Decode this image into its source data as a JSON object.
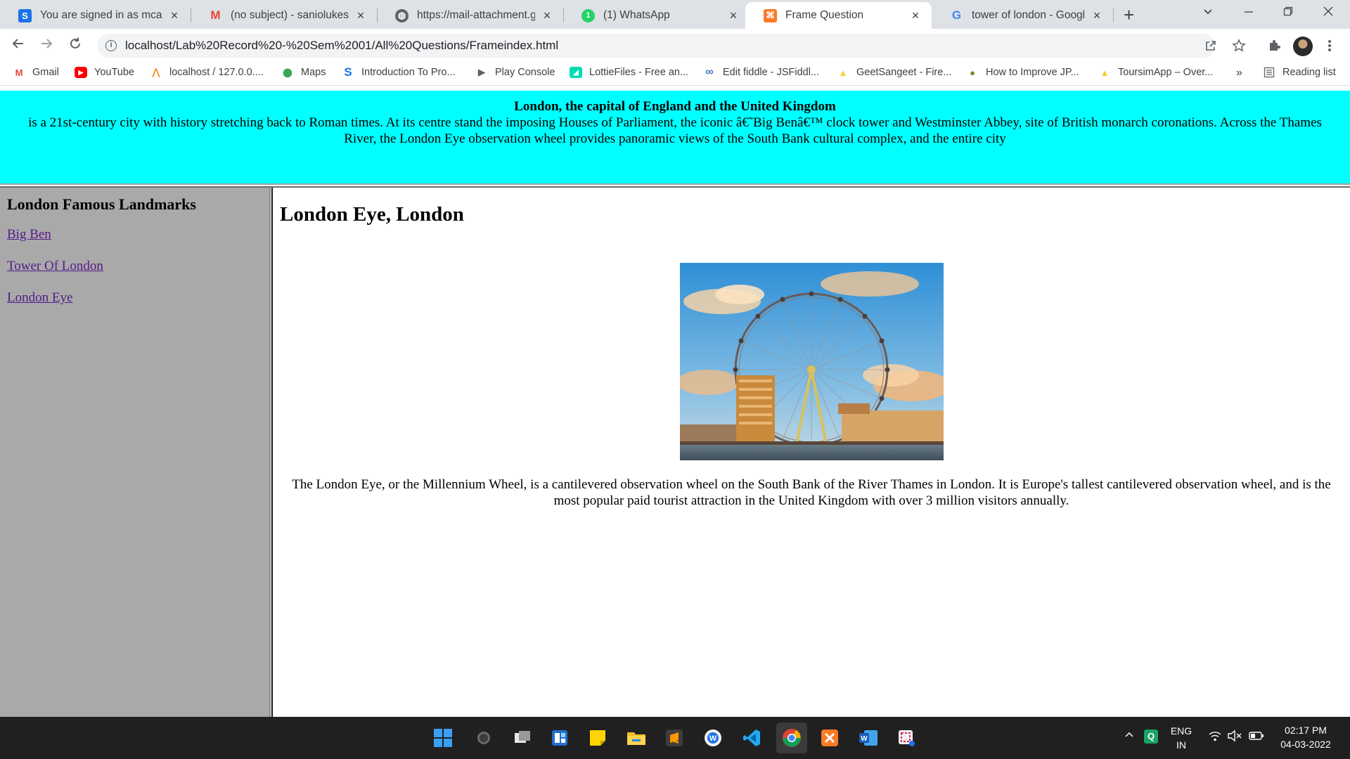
{
  "browser": {
    "tabs": [
      {
        "title": "You are signed in as mca",
        "icon": "s-icon",
        "color": "#1a73e8",
        "glyph": "S"
      },
      {
        "title": "(no subject) - saniolukeseb",
        "icon": "gmail-icon",
        "color": "#ea4335",
        "glyph": "M"
      },
      {
        "title": "https://mail-attachment.go",
        "icon": "globe-icon",
        "color": "#5f6368",
        "glyph": "◍"
      },
      {
        "title": "(1) WhatsApp",
        "icon": "whatsapp-icon",
        "color": "#25d366",
        "glyph": "1"
      },
      {
        "title": "Frame Question",
        "icon": "xampp-icon",
        "color": "#fb7a24",
        "glyph": "⌘"
      },
      {
        "title": "tower of london - Google S",
        "icon": "google-icon",
        "color": "#4285f4",
        "glyph": "G"
      }
    ],
    "close_glyph": "×",
    "new_tab_glyph": "+",
    "url": "localhost/Lab%20Record%20-%20Sem%2001/All%20Questions/Frameindex.html",
    "bookmarks": [
      {
        "label": "Gmail",
        "icon": "gmail-icon",
        "color": "#ea4335",
        "glyph": "M"
      },
      {
        "label": "YouTube",
        "icon": "youtube-icon",
        "color": "#ff0000",
        "glyph": "▶"
      },
      {
        "label": "localhost / 127.0.0....",
        "icon": "phpmyadmin-icon",
        "color": "#f29111",
        "glyph": "⋀"
      },
      {
        "label": "Maps",
        "icon": "maps-icon",
        "color": "#34a853",
        "glyph": "⬤"
      },
      {
        "label": "Introduction To Pro...",
        "icon": "s-icon",
        "color": "#1a73e8",
        "glyph": "S"
      },
      {
        "label": "Play Console",
        "icon": "play-console-icon",
        "color": "#5f6368",
        "glyph": "▶"
      },
      {
        "label": "LottieFiles - Free an...",
        "icon": "lottiefiles-icon",
        "color": "#00ddb3",
        "glyph": "◢"
      },
      {
        "label": "Edit fiddle - JSFiddl...",
        "icon": "jsfiddle-icon",
        "color": "#4679bd",
        "glyph": "∞"
      },
      {
        "label": "GeetSangeet - Fire...",
        "icon": "firebase-icon",
        "color": "#ffca28",
        "glyph": "▲"
      },
      {
        "label": "How to Improve JP...",
        "icon": "site-icon",
        "color": "#6b8e23",
        "glyph": "●"
      },
      {
        "label": "ToursimApp – Over...",
        "icon": "firebase-icon",
        "color": "#ffca28",
        "glyph": "▲"
      }
    ],
    "more_bookmarks": "»",
    "reading_list": "Reading list"
  },
  "page": {
    "banner_title": "London, the capital of England and the United Kingdom",
    "banner_text": "is a 21st-century city with history stretching back to Roman times. At its centre stand the imposing Houses of Parliament, the iconic â€˜Big Benâ€™ clock tower and Westminster Abbey, site of British monarch coronations. Across the Thames River, the London Eye observation wheel provides panoramic views of the South Bank cultural complex, and the entire city",
    "banner_color": "#00ffff",
    "sidebar": {
      "heading": "London Famous Landmarks",
      "links": [
        "Big Ben",
        "Tower Of London",
        "London Eye"
      ],
      "background": "#a9a9a9"
    },
    "content": {
      "heading": "London Eye, London",
      "description": "The London Eye, or the Millennium Wheel, is a cantilevered observation wheel on the South Bank of the River Thames in London. It is Europe's tallest cantilevered observation wheel, and is the most popular paid tourist attraction in the United Kingdom with over 3 million visitors annually."
    }
  },
  "taskbar": {
    "lang": "ENG",
    "region": "IN",
    "time": "02:17 PM",
    "date": "04-03-2022"
  }
}
